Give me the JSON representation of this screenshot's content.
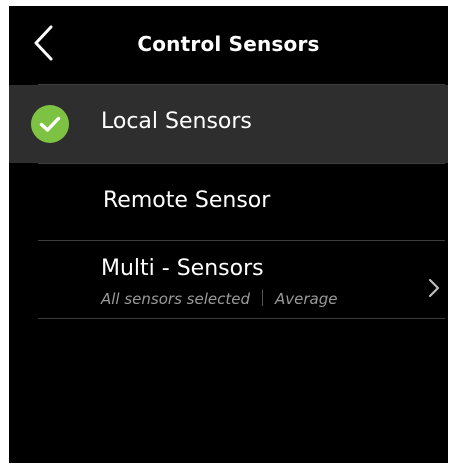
{
  "header": {
    "title": "Control Sensors",
    "back_icon": "chevron-left-icon"
  },
  "options": {
    "local": {
      "label": "Local Sensors",
      "selected": true,
      "icon": "check-circle-icon"
    },
    "remote": {
      "label": "Remote Sensor",
      "selected": false
    },
    "multi": {
      "label": "Multi - Sensors",
      "subtitle_left": "All sensors selected",
      "subtitle_right": "Average",
      "icon": "chevron-right-icon"
    }
  },
  "colors": {
    "background": "#000000",
    "selected_row": "#2e2e2e",
    "check_green": "#7dc243",
    "text": "#ffffff",
    "subtext": "#9a9a9a"
  }
}
